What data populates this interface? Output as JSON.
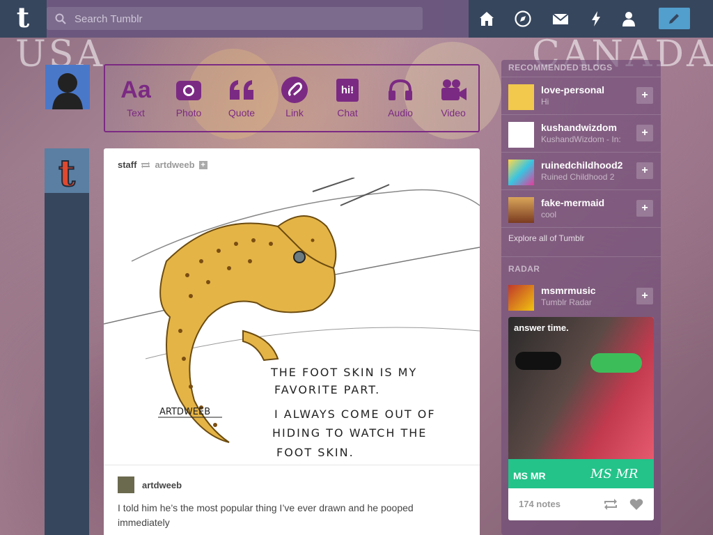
{
  "background": {
    "left_text": "USA",
    "right_text": "CANADA"
  },
  "header": {
    "search_placeholder": "Search Tumblr",
    "nav_icons": [
      "home-icon",
      "explore-compass-icon",
      "messages-envelope-icon",
      "activity-bolt-icon",
      "account-person-icon"
    ],
    "compose_icon": "pencil-icon",
    "colors": {
      "bar": "#36465d",
      "compose": "#529ecc"
    }
  },
  "post_types": [
    {
      "label": "Text",
      "icon": "Aa"
    },
    {
      "label": "Photo",
      "icon": "camera-icon"
    },
    {
      "label": "Quote",
      "icon": "quote-icon"
    },
    {
      "label": "Link",
      "icon": "link-icon"
    },
    {
      "label": "Chat",
      "icon": "hi!"
    },
    {
      "label": "Audio",
      "icon": "headphones-icon"
    },
    {
      "label": "Video",
      "icon": "video-camera-icon"
    }
  ],
  "post": {
    "author": "staff",
    "reblogged_from": "artdweeb",
    "art_signature": "ARTDWEEB",
    "art_caption_lines": [
      "THE FOOT SKIN IS MY",
      "FAVORITE PART.",
      "I ALWAYS COME OUT OF",
      "HIDING TO WATCH THE",
      "FOOT SKIN."
    ],
    "reblog_author": "artdweeb",
    "body": "I told him he’s the most popular thing I’ve ever drawn and he pooped immediately"
  },
  "sidebar": {
    "recommended_title": "RECOMMENDED BLOGS",
    "blogs": [
      {
        "name": "love-personal",
        "subtitle": "Hi"
      },
      {
        "name": "kushandwizdom",
        "subtitle": "KushandWizdom - In:"
      },
      {
        "name": "ruinedchildhood2",
        "subtitle": "Ruined Childhood 2"
      },
      {
        "name": "fake-mermaid",
        "subtitle": "cool"
      }
    ],
    "explore_link": "Explore all of Tumblr",
    "radar_title": "RADAR",
    "radar_blog": {
      "name": "msmrmusic",
      "subtitle": "Tumblr Radar"
    },
    "radar_post": {
      "overlay": "answer time.",
      "band_left": "MS MR",
      "band_right": "MS MR",
      "notes": "174 notes"
    }
  }
}
